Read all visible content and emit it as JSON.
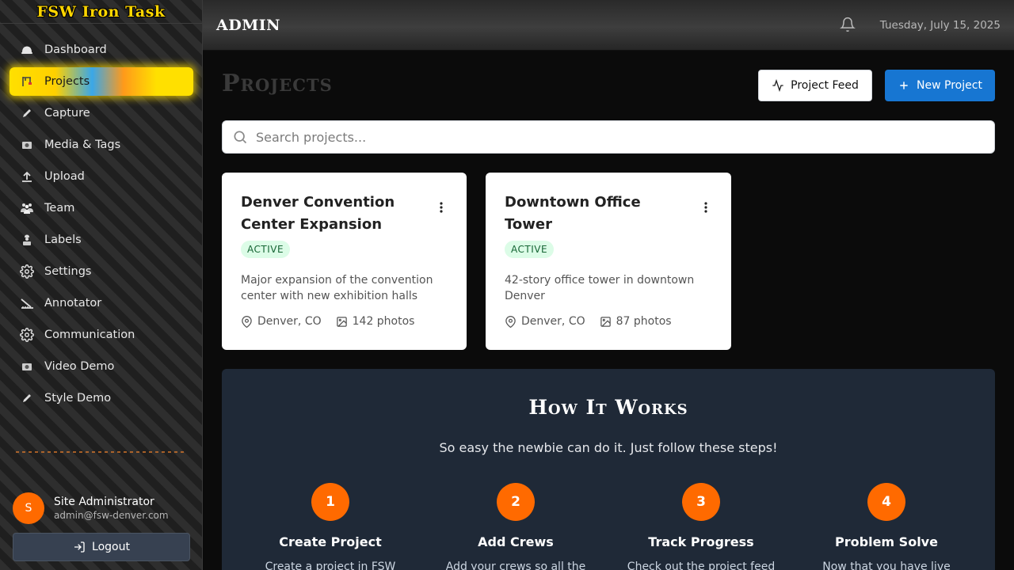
{
  "brand": "FSW Iron Task",
  "sidebar": {
    "items": [
      {
        "label": "Dashboard",
        "icon": "hardhat-icon"
      },
      {
        "label": "Projects",
        "icon": "crane-icon",
        "active": true
      },
      {
        "label": "Capture",
        "icon": "pencil-icon"
      },
      {
        "label": "Media & Tags",
        "icon": "camera-icon"
      },
      {
        "label": "Upload",
        "icon": "upload-icon"
      },
      {
        "label": "Team",
        "icon": "team-icon"
      },
      {
        "label": "Labels",
        "icon": "worker-icon"
      },
      {
        "label": "Settings",
        "icon": "gear-icon"
      },
      {
        "label": "Annotator",
        "icon": "ruler-icon"
      },
      {
        "label": "Communication",
        "icon": "gear-icon"
      },
      {
        "label": "Video Demo",
        "icon": "camera-icon"
      },
      {
        "label": "Style Demo",
        "icon": "pencil-icon"
      }
    ]
  },
  "user": {
    "initial": "S",
    "name": "Site Administrator",
    "email": "admin@fsw-denver.com",
    "logout_label": "Logout"
  },
  "header": {
    "title": "ADMIN",
    "date": "Tuesday, July 15, 2025"
  },
  "main": {
    "page_title": "Projects",
    "feed_button": "Project Feed",
    "new_button": "New Project",
    "search_placeholder": "Search projects..."
  },
  "projects": [
    {
      "title": "Denver Convention Center Expansion",
      "status": "ACTIVE",
      "description": "Major expansion of the convention center with new exhibition halls",
      "location": "Denver, CO",
      "photos": "142 photos"
    },
    {
      "title": "Downtown Office Tower",
      "status": "ACTIVE",
      "description": "42-story office tower in downtown Denver",
      "location": "Denver, CO",
      "photos": "87 photos"
    }
  ],
  "how_it_works": {
    "title": "How It Works",
    "subtitle": "So easy the newbie can do it. Just follow these steps!",
    "steps": [
      {
        "number": "1",
        "title": "Create Project",
        "description": "Create a project in FSW Iron"
      },
      {
        "number": "2",
        "title": "Add Crews",
        "description": "Add your crews so all the"
      },
      {
        "number": "3",
        "title": "Track Progress",
        "description": "Check out the project feed on"
      },
      {
        "number": "4",
        "title": "Problem Solve",
        "description": "Now that you have live"
      }
    ]
  },
  "colors": {
    "accent_orange": "#ff6a00",
    "primary_blue": "#1776d2",
    "brand_yellow": "#ffd600",
    "active_badge_bg": "#dcfce7"
  }
}
